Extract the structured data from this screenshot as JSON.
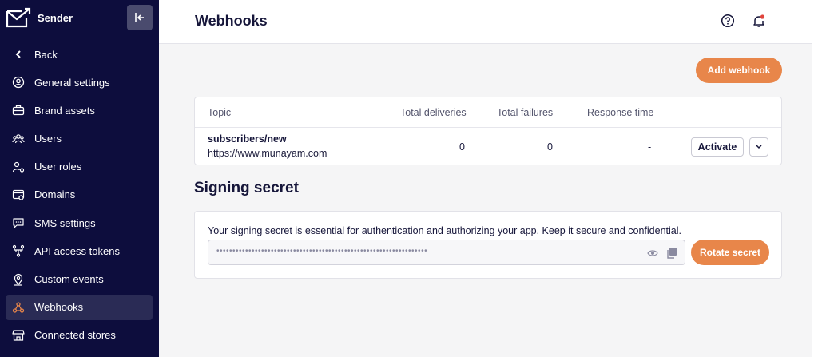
{
  "brand": {
    "name": "Sender"
  },
  "sidebar": {
    "items": [
      {
        "label": "Back",
        "icon": "chevron-left-icon"
      },
      {
        "label": "General settings",
        "icon": "user-circle-icon"
      },
      {
        "label": "Brand assets",
        "icon": "briefcase-icon"
      },
      {
        "label": "Users",
        "icon": "users-icon"
      },
      {
        "label": "User roles",
        "icon": "user-roles-icon"
      },
      {
        "label": "Domains",
        "icon": "domains-icon"
      },
      {
        "label": "SMS settings",
        "icon": "sms-icon"
      },
      {
        "label": "API access tokens",
        "icon": "api-icon"
      },
      {
        "label": "Custom events",
        "icon": "location-pin-icon"
      },
      {
        "label": "Webhooks",
        "icon": "webhooks-icon",
        "active": true
      },
      {
        "label": "Connected stores",
        "icon": "store-icon"
      }
    ]
  },
  "header": {
    "title": "Webhooks"
  },
  "actions": {
    "add_webhook": "Add webhook"
  },
  "table": {
    "columns": [
      "Topic",
      "Total deliveries",
      "Total failures",
      "Response time"
    ],
    "rows": [
      {
        "topic": "subscribers/new",
        "url": "https://www.munayam.com",
        "total_deliveries": "0",
        "total_failures": "0",
        "response_time": "-",
        "action": "Activate"
      }
    ]
  },
  "signing": {
    "title": "Signing secret",
    "description": "Your signing secret is essential for authentication and authorizing your app. Keep it secure and confidential.",
    "masked_value": "••••••••••••••••••••••••••••••••••••••••••••••••••••••••••••••••••",
    "rotate_label": "Rotate secret"
  },
  "colors": {
    "sidebar_bg": "#0d0d3d",
    "accent": "#e8864a",
    "active_item_bg": "#2a2b55",
    "notification_dot": "#e0453c"
  }
}
